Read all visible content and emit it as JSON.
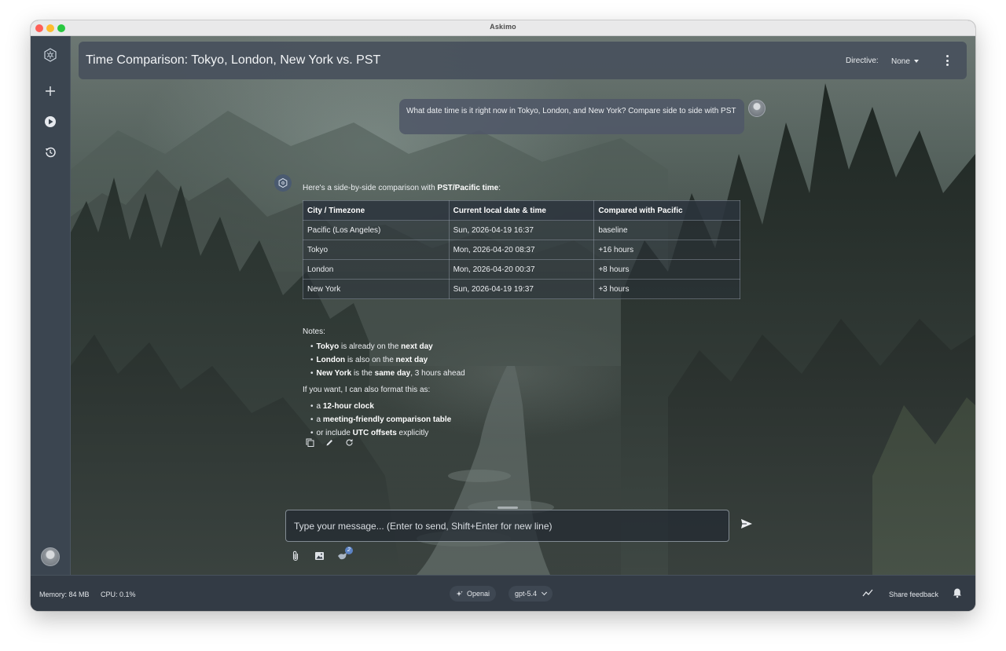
{
  "window": {
    "title": "Askimo"
  },
  "header": {
    "title": "Time Comparison: Tokyo, London, New York vs. PST",
    "directive_label": "Directive:",
    "directive_value": "None"
  },
  "user_message": "What date time is it right now in Tokyo, London, and New York? Compare side to side with PST",
  "assistant": {
    "intro_prefix": "Here's a side-by-side comparison with ",
    "intro_bold": "PST/Pacific time",
    "intro_suffix": ":",
    "table": {
      "headers": [
        "City / Timezone",
        "Current local date & time",
        "Compared with Pacific"
      ],
      "rows": [
        [
          "Pacific (Los Angeles)",
          "Sun, 2026-04-19 16:37",
          "baseline"
        ],
        [
          "Tokyo",
          "Mon, 2026-04-20 08:37",
          "+16 hours"
        ],
        [
          "London",
          "Mon, 2026-04-20 00:37",
          "+8 hours"
        ],
        [
          "New York",
          "Sun, 2026-04-19 19:37",
          "+3 hours"
        ]
      ]
    },
    "notes_label": "Notes:",
    "notes": [
      {
        "b1": "Tokyo",
        "t1": " is already on the ",
        "b2": "next day",
        "t2": ""
      },
      {
        "b1": "London",
        "t1": " is also on the ",
        "b2": "next day",
        "t2": ""
      },
      {
        "b1": "New York",
        "t1": " is the ",
        "b2": "same day",
        "t2": ", 3 hours ahead"
      }
    ],
    "format_label": "If you want, I can also format this as:",
    "formats": [
      {
        "t1": "a ",
        "b1": "12-hour clock",
        "t2": ""
      },
      {
        "t1": "a ",
        "b1": "meeting-friendly comparison table",
        "t2": ""
      },
      {
        "t1": "or include ",
        "b1": "UTC offsets",
        "t2": " explicitly"
      }
    ]
  },
  "composer": {
    "placeholder": "Type your message... (Enter to send, Shift+Enter for new line)",
    "badge_count": "2"
  },
  "status": {
    "memory": "Memory: 84 MB",
    "cpu": "CPU: 0.1%",
    "provider": "Openai",
    "model": "gpt-5.4",
    "feedback": "Share feedback"
  },
  "icons": {
    "sidebar": [
      "logo-icon",
      "plus-icon",
      "play-icon",
      "history-icon"
    ],
    "actions": [
      "copy-icon",
      "edit-icon",
      "refresh-icon"
    ],
    "tools": [
      "paperclip-icon",
      "image-icon",
      "tools-icon"
    ],
    "status": [
      "sparkle-icon",
      "chart-icon",
      "bell-icon"
    ]
  },
  "colors": {
    "sidebar": "#3b4550",
    "header": "#48505c",
    "statusbar": "#333b45",
    "accent": "#5b82c4"
  }
}
